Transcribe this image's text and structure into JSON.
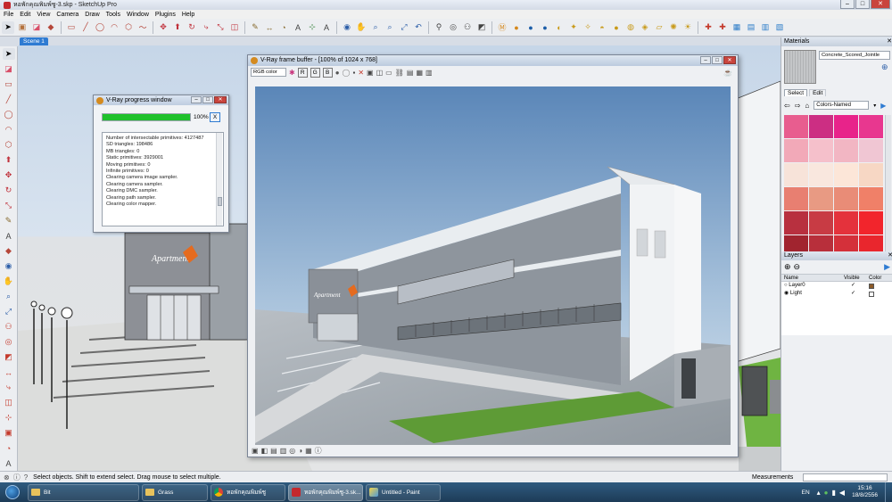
{
  "window": {
    "title": "หอพักคุณพิมพ์ชู-3.skp - SketchUp Pro",
    "minimize": "–",
    "maximize": "□",
    "close": "✕"
  },
  "menu": [
    "File",
    "Edit",
    "View",
    "Camera",
    "Draw",
    "Tools",
    "Window",
    "Plugins",
    "Help"
  ],
  "scene_tab": "Scene 1",
  "vray_progress": {
    "title": "V-Ray progress window",
    "percent": "100%",
    "progress_value": 1.0,
    "cancel_label": "X",
    "log": [
      "Number of intersectable primitives: 4127487",
      "SD triangles: 198486",
      "MB triangles: 0",
      "Static primitives: 3929001",
      "Moving primitives: 0",
      "Infinite primitives: 0",
      "Clearing camera image sampler.",
      "Clearing camera sampler.",
      "Clearing DMC sampler.",
      "Clearing path sampler.",
      "Clearing color mapper."
    ]
  },
  "vray_frame_buffer": {
    "title": "V-Ray frame buffer - [100% of 1024 x 768]",
    "channel": "RGB color",
    "r": "R",
    "g": "G",
    "b": "B"
  },
  "materials": {
    "title": "Materials",
    "current": "Concrete_Scored_Jointle",
    "tab_select": "Select",
    "tab_edit": "Edit",
    "library": "Colors-Named",
    "swatches": [
      "#e85d8f",
      "#cc2e83",
      "#e8238a",
      "#e8378f",
      "#f2a9b8",
      "#f5c0cb",
      "#f2b6c3",
      "#f0c6d3",
      "#f7e3d9",
      "#f9e7de",
      "#fce6d8",
      "#f7d7c4",
      "#e87f71",
      "#e89a83",
      "#e98c77",
      "#f08068",
      "#b8303f",
      "#c83b44",
      "#e4323c",
      "#f2252c",
      "#a1242f",
      "#b82f3b",
      "#d4303a",
      "#e9262d"
    ]
  },
  "layers": {
    "title": "Layers",
    "columns": [
      "Name",
      "Visible",
      "Color"
    ],
    "rows": [
      {
        "name": "Layer0",
        "visible": "✓",
        "color": "#8c5a28"
      },
      {
        "name": "Light",
        "visible": "✓",
        "color": "#ffffff"
      }
    ]
  },
  "status": {
    "message": "Select objects. Shift to extend select. Drag mouse to select multiple.",
    "measurements_label": "Measurements"
  },
  "taskbar": {
    "items": [
      {
        "label": "Bit",
        "icon": "folder-icon"
      },
      {
        "label": "Grass",
        "icon": "folder-icon"
      },
      {
        "label": "หอพักคุณพิมพ์ชู",
        "icon": "chrome-icon"
      },
      {
        "label": "หอพักคุณพิมพ์ชู-3.sk...",
        "icon": "sketchup-icon"
      },
      {
        "label": "Untitled - Paint",
        "icon": "paint-icon"
      }
    ],
    "language": "EN",
    "time": "15:16",
    "date": "18/8/2556"
  },
  "render_signage": "Apartment",
  "colors": {
    "accent": "#2e7bd2",
    "progress_green": "#20c12c",
    "taskbar": "#23425f"
  }
}
